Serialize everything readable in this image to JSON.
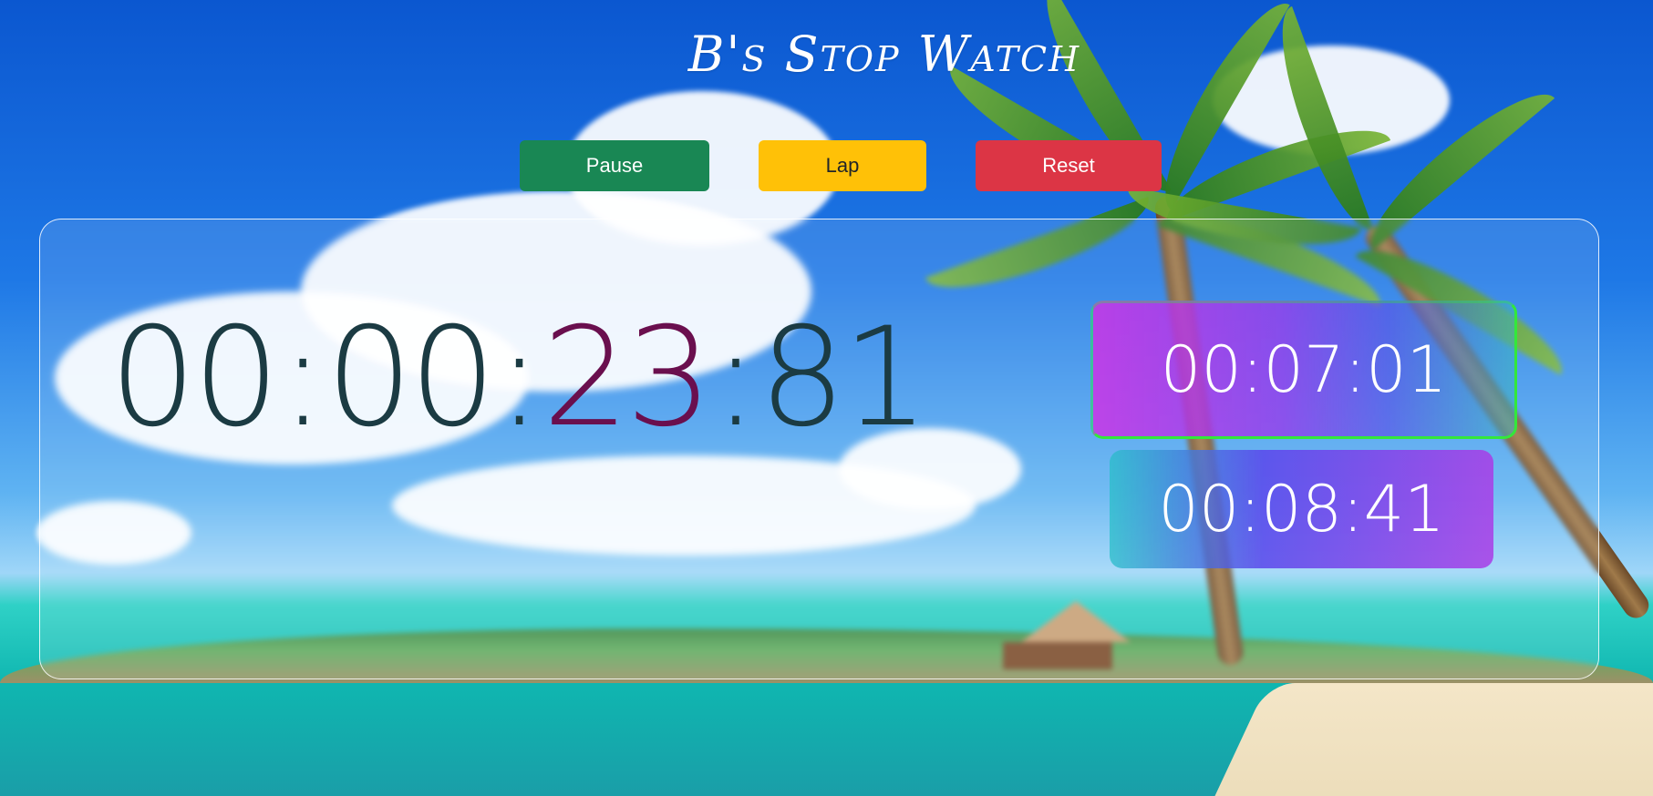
{
  "app": {
    "title": "B's Stop Watch"
  },
  "controls": {
    "pause_label": "Pause",
    "lap_label": "Lap",
    "reset_label": "Reset"
  },
  "timer": {
    "hours": "00",
    "minutes": "00",
    "seconds": "23",
    "centiseconds": "81",
    "separator": ":"
  },
  "laps": [
    {
      "time": "00:07:01"
    },
    {
      "time": "00:08:41"
    }
  ],
  "colors": {
    "pause_button": "#198754",
    "lap_button": "#ffc107",
    "reset_button": "#dc3545",
    "timer_text": "#1b3b43",
    "seconds_highlight": "#6a0f4e",
    "active_lap_border": "#33e83a"
  }
}
